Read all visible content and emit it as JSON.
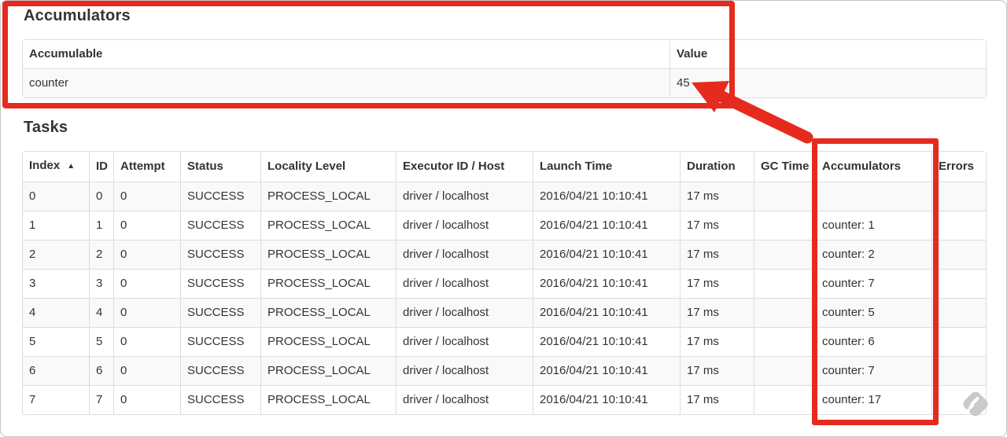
{
  "accumulators_section": {
    "title": "Accumulators",
    "table": {
      "columns": [
        {
          "key": "name",
          "label": "Accumulable"
        },
        {
          "key": "value",
          "label": "Value"
        }
      ],
      "rows": [
        {
          "name": "counter",
          "value": "45"
        }
      ]
    }
  },
  "tasks_section": {
    "title": "Tasks",
    "table": {
      "columns": [
        {
          "key": "index",
          "label": "Index"
        },
        {
          "key": "id",
          "label": "ID"
        },
        {
          "key": "attempt",
          "label": "Attempt"
        },
        {
          "key": "status",
          "label": "Status"
        },
        {
          "key": "locality",
          "label": "Locality Level"
        },
        {
          "key": "executor",
          "label": "Executor ID / Host"
        },
        {
          "key": "launch",
          "label": "Launch Time"
        },
        {
          "key": "duration",
          "label": "Duration"
        },
        {
          "key": "gc",
          "label": "GC Time"
        },
        {
          "key": "accumulators",
          "label": "Accumulators"
        },
        {
          "key": "errors",
          "label": "Errors"
        }
      ],
      "sort": {
        "column": "index",
        "icon": "▲",
        "direction": "ascending"
      },
      "rows": [
        {
          "index": "0",
          "id": "0",
          "attempt": "0",
          "status": "SUCCESS",
          "locality": "PROCESS_LOCAL",
          "executor": "driver / localhost",
          "launch": "2016/04/21 10:10:41",
          "duration": "17 ms",
          "gc": "",
          "accumulators": "",
          "errors": ""
        },
        {
          "index": "1",
          "id": "1",
          "attempt": "0",
          "status": "SUCCESS",
          "locality": "PROCESS_LOCAL",
          "executor": "driver / localhost",
          "launch": "2016/04/21 10:10:41",
          "duration": "17 ms",
          "gc": "",
          "accumulators": "counter: 1",
          "errors": ""
        },
        {
          "index": "2",
          "id": "2",
          "attempt": "0",
          "status": "SUCCESS",
          "locality": "PROCESS_LOCAL",
          "executor": "driver / localhost",
          "launch": "2016/04/21 10:10:41",
          "duration": "17 ms",
          "gc": "",
          "accumulators": "counter: 2",
          "errors": ""
        },
        {
          "index": "3",
          "id": "3",
          "attempt": "0",
          "status": "SUCCESS",
          "locality": "PROCESS_LOCAL",
          "executor": "driver / localhost",
          "launch": "2016/04/21 10:10:41",
          "duration": "17 ms",
          "gc": "",
          "accumulators": "counter: 7",
          "errors": ""
        },
        {
          "index": "4",
          "id": "4",
          "attempt": "0",
          "status": "SUCCESS",
          "locality": "PROCESS_LOCAL",
          "executor": "driver / localhost",
          "launch": "2016/04/21 10:10:41",
          "duration": "17 ms",
          "gc": "",
          "accumulators": "counter: 5",
          "errors": ""
        },
        {
          "index": "5",
          "id": "5",
          "attempt": "0",
          "status": "SUCCESS",
          "locality": "PROCESS_LOCAL",
          "executor": "driver / localhost",
          "launch": "2016/04/21 10:10:41",
          "duration": "17 ms",
          "gc": "",
          "accumulators": "counter: 6",
          "errors": ""
        },
        {
          "index": "6",
          "id": "6",
          "attempt": "0",
          "status": "SUCCESS",
          "locality": "PROCESS_LOCAL",
          "executor": "driver / localhost",
          "launch": "2016/04/21 10:10:41",
          "duration": "17 ms",
          "gc": "",
          "accumulators": "counter: 7",
          "errors": ""
        },
        {
          "index": "7",
          "id": "7",
          "attempt": "0",
          "status": "SUCCESS",
          "locality": "PROCESS_LOCAL",
          "executor": "driver / localhost",
          "launch": "2016/04/21 10:10:41",
          "duration": "17 ms",
          "gc": "",
          "accumulators": "counter: 17",
          "errors": ""
        }
      ]
    }
  },
  "annotations": {
    "color": "#e62b1e",
    "accumulators_box": "highlight around Accumulators section",
    "column_box": "highlight around Accumulators task column",
    "arrow": "from Accumulators column to value 45"
  },
  "watermark": {
    "icon": "skitch-pencil-icon",
    "color": "#cacaca"
  }
}
